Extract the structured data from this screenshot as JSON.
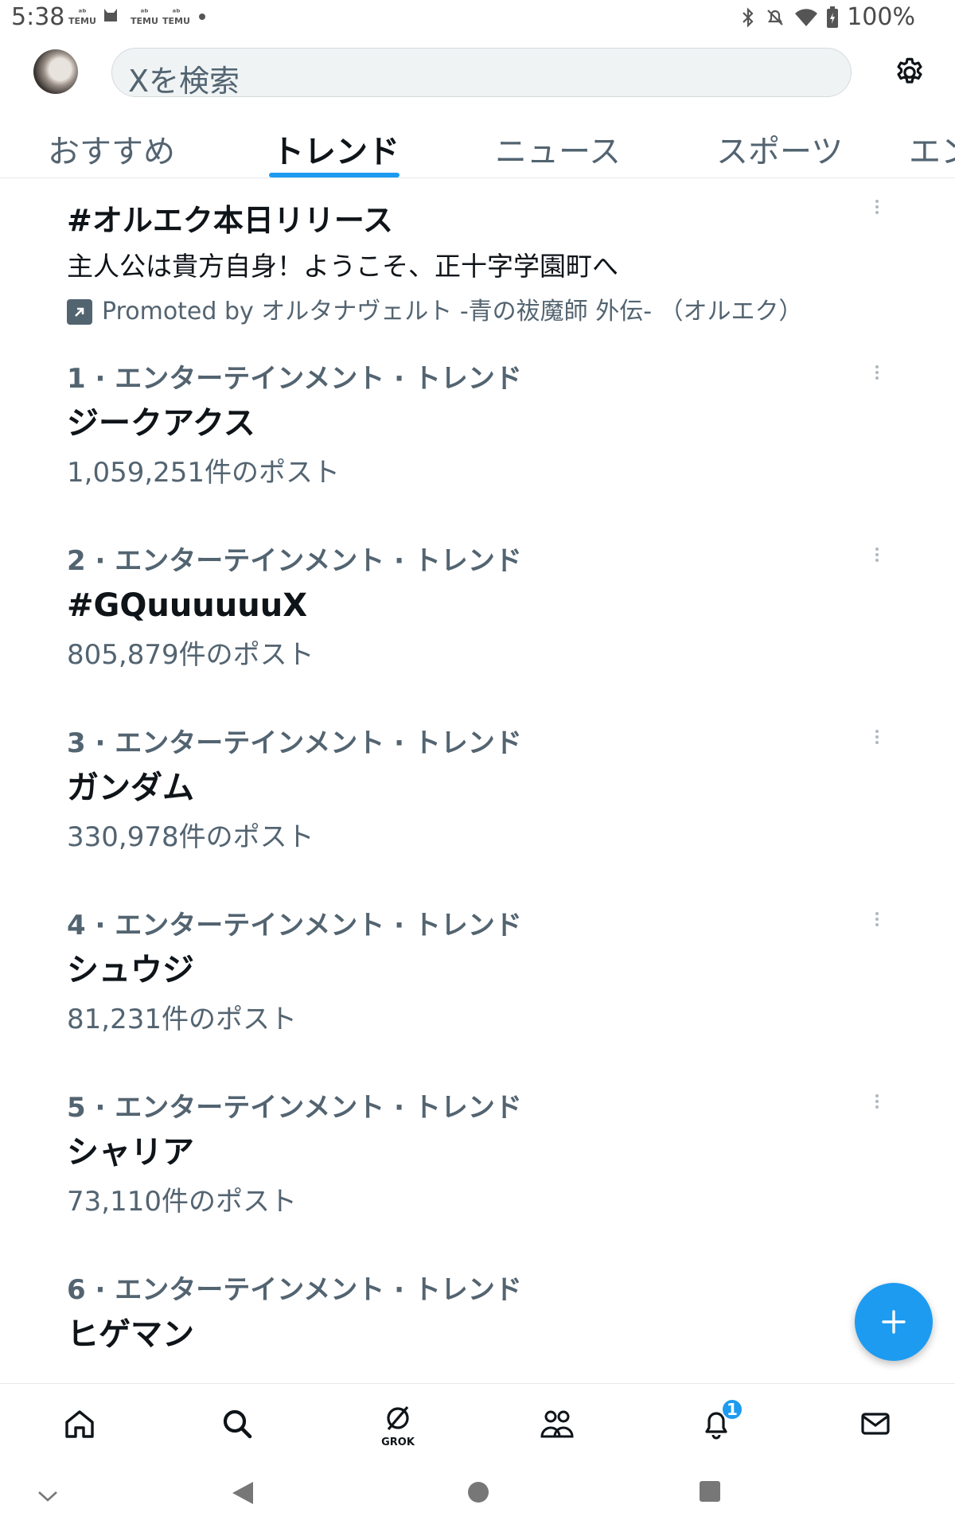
{
  "status_bar": {
    "time": "5:38",
    "notif_app_label": "TEMU",
    "battery": "100%"
  },
  "search": {
    "placeholder": "Xを検索"
  },
  "tabs": [
    {
      "label": "おすすめ",
      "active": false
    },
    {
      "label": "トレンド",
      "active": true
    },
    {
      "label": "ニュース",
      "active": false
    },
    {
      "label": "スポーツ",
      "active": false
    },
    {
      "label": "エンタ",
      "active": false
    }
  ],
  "promoted": {
    "title": "#オルエク本日リリース",
    "description": "主人公は貴方自身！ようこそ、正十字学園町へ",
    "promoted_by": "Promoted by オルタナヴェルト -青の祓魔師 外伝- （オルエク）"
  },
  "trends": [
    {
      "meta": "1 · エンターテインメント · トレンド",
      "name": "ジークアクス",
      "count": "1,059,251件のポスト"
    },
    {
      "meta": "2 · エンターテインメント · トレンド",
      "name": "#GQuuuuuuX",
      "count": "805,879件のポスト"
    },
    {
      "meta": "3 · エンターテインメント · トレンド",
      "name": "ガンダム",
      "count": "330,978件のポスト"
    },
    {
      "meta": "4 · エンターテインメント · トレンド",
      "name": "シュウジ",
      "count": "81,231件のポスト"
    },
    {
      "meta": "5 · エンターテインメント · トレンド",
      "name": "シャリア",
      "count": "73,110件のポスト"
    },
    {
      "meta": "6 · エンターテインメント · トレンド",
      "name": "ヒゲマン",
      "count": ""
    }
  ],
  "bottom_nav": {
    "grok_label": "GROK",
    "notification_badge": "1"
  },
  "colors": {
    "accent": "#1d9bf0",
    "text_primary": "#0f1419",
    "text_secondary": "#536471"
  }
}
